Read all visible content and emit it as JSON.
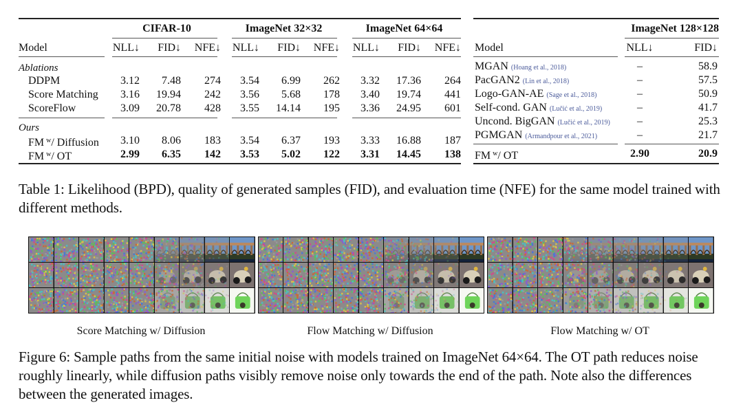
{
  "table1": {
    "left": {
      "groups": [
        "CIFAR-10",
        "ImageNet 32×32",
        "ImageNet 64×64"
      ],
      "model_header": "Model",
      "metrics": [
        "NLL↓",
        "FID↓",
        "NFE↓",
        "NLL↓",
        "FID↓",
        "NFE↓",
        "NLL↓",
        "FID↓",
        "NFE↓"
      ],
      "sections": [
        {
          "title": "Ablations",
          "rows": [
            {
              "model": "DDPM",
              "values": [
                "3.12",
                "7.48",
                "274",
                "3.54",
                "6.99",
                "262",
                "3.32",
                "17.36",
                "264"
              ]
            },
            {
              "model": "Score Matching",
              "values": [
                "3.16",
                "19.94",
                "242",
                "3.56",
                "5.68",
                "178",
                "3.40",
                "19.74",
                "441"
              ]
            },
            {
              "model": "ScoreFlow",
              "values": [
                "3.09",
                "20.78",
                "428",
                "3.55",
                "14.14",
                "195",
                "3.36",
                "24.95",
                "601"
              ]
            }
          ]
        },
        {
          "title": "Ours",
          "rows": [
            {
              "model": "FM",
              "sup": "w",
              "suffix": "/ Diffusion",
              "values": [
                "3.10",
                "8.06",
                "183",
                "3.54",
                "6.37",
                "193",
                "3.33",
                "16.88",
                "187"
              ]
            },
            {
              "model": "FM",
              "sup": "w",
              "suffix": "/ OT",
              "bold": true,
              "values": [
                "2.99",
                "6.35",
                "142",
                "3.53",
                "5.02",
                "122",
                "3.31",
                "14.45",
                "138"
              ]
            }
          ]
        }
      ]
    },
    "right": {
      "group": "ImageNet 128×128",
      "model_header": "Model",
      "metrics": [
        "NLL↓",
        "FID↓"
      ],
      "rows": [
        {
          "model": "MGAN",
          "cite": "(Hoang et al., 2018)",
          "nll": "–",
          "fid": "58.9"
        },
        {
          "model": "PacGAN2",
          "cite": "(Lin et al., 2018)",
          "nll": "–",
          "fid": "57.5"
        },
        {
          "model": "Logo-GAN-AE",
          "cite": "(Sage et al., 2018)",
          "nll": "–",
          "fid": "50.9"
        },
        {
          "model": "Self-cond. GAN",
          "cite": "(Lučić et al., 2019)",
          "nll": "–",
          "fid": "41.7"
        },
        {
          "model": "Uncond. BigGAN",
          "cite": "(Lučić et al., 2019)",
          "nll": "–",
          "fid": "25.3"
        },
        {
          "model": "PGMGAN",
          "cite": "(Armandpour et al., 2021)",
          "nll": "–",
          "fid": "21.7"
        }
      ],
      "ours": {
        "model": "FM",
        "sup": "w",
        "suffix": "/ OT",
        "nll": "2.90",
        "fid": "20.9"
      }
    },
    "caption": "Table 1: Likelihood (BPD), quality of generated samples (FID), and evaluation time (NFE) for the same model trained with different methods."
  },
  "figure6": {
    "panels": [
      {
        "label": "Score Matching w/ Diffusion",
        "clear_from": [
          6,
          6,
          6
        ]
      },
      {
        "label": "Flow Matching w/ Diffusion",
        "clear_from": [
          6,
          6,
          6
        ]
      },
      {
        "label": "Flow Matching w/ OT",
        "clear_from": [
          4,
          4,
          4
        ]
      }
    ],
    "rows": [
      "aqueduct",
      "scooter",
      "green-basket"
    ],
    "steps": 9,
    "caption": "Figure 6: Sample paths from the same initial noise with models trained on ImageNet 64×64. The OT path reduces noise roughly linearly, while diffusion paths visibly remove noise only towards the end of the path. Note also the differences between the generated images."
  },
  "colors": {
    "citation": "#4a5a9a",
    "rule": "#222222"
  }
}
